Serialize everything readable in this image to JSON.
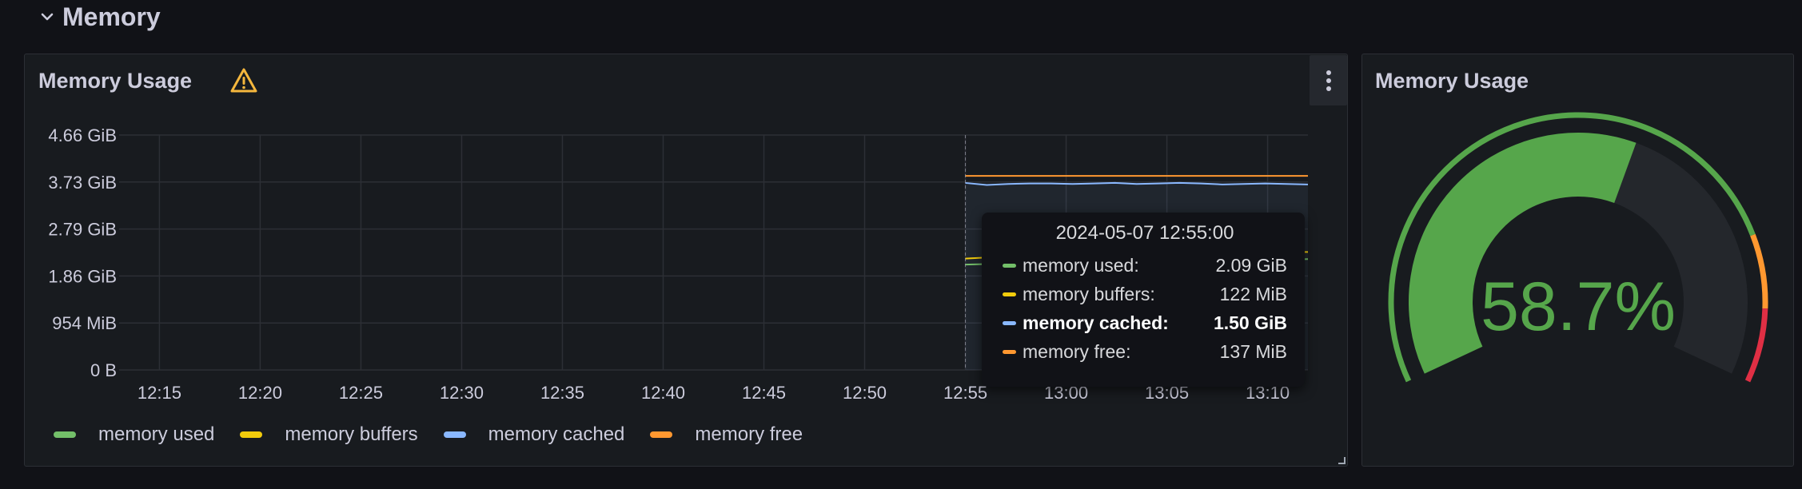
{
  "row": {
    "title": "Memory"
  },
  "graph_panel": {
    "title": "Memory Usage",
    "tooltip": {
      "time": "2024-05-07 12:55:00",
      "rows": [
        {
          "name": "memory used:",
          "value": "2.09 GiB",
          "color": "#73bf69"
        },
        {
          "name": "memory buffers:",
          "value": "122 MiB",
          "color": "#f2cc0c"
        },
        {
          "name": "memory cached:",
          "value": "1.50 GiB",
          "color": "#8ab8ff"
        },
        {
          "name": "memory free:",
          "value": "137 MiB",
          "color": "#ff9830"
        }
      ]
    },
    "legend": [
      {
        "label": "memory used",
        "color": "#73bf69"
      },
      {
        "label": "memory buffers",
        "color": "#f2cc0c"
      },
      {
        "label": "memory cached",
        "color": "#8ab8ff"
      },
      {
        "label": "memory free",
        "color": "#ff9830"
      }
    ]
  },
  "gauge_panel": {
    "title": "Memory Usage",
    "value_text": "58.7%",
    "value": 58.7,
    "min": 0,
    "max": 100,
    "value_color": "#56a64b",
    "threshold_colors": [
      "#56a64b",
      "#ff9830",
      "#e02f44"
    ]
  },
  "chart_data": {
    "type": "line",
    "y_ticks": [
      "0 B",
      "954 MiB",
      "1.86 GiB",
      "2.79 GiB",
      "3.73 GiB",
      "4.66 GiB"
    ],
    "x_ticks": [
      "12:15",
      "12:20",
      "12:25",
      "12:30",
      "12:35",
      "12:40",
      "12:45",
      "12:50",
      "12:55",
      "13:00",
      "13:05",
      "13:10"
    ],
    "x_start_minute": "12:13",
    "x_end_minute": "13:12",
    "ylim_gib": [
      0,
      4.66
    ],
    "data_start": "12:55",
    "series": [
      {
        "name": "memory used",
        "color": "#73bf69",
        "values_gib": [
          2.09,
          2.1,
          2.12,
          2.11,
          2.13,
          2.12,
          2.14,
          2.15,
          2.13,
          2.14,
          2.16,
          2.15,
          2.17,
          2.18,
          2.17,
          2.19,
          2.2
        ]
      },
      {
        "name": "memory buffers",
        "color": "#f2cc0c",
        "values_gib": [
          2.21,
          2.23,
          2.24,
          2.25,
          2.26,
          2.27,
          2.27,
          2.28,
          2.29,
          2.3,
          2.3,
          2.31,
          2.32,
          2.32,
          2.33,
          2.34,
          2.34
        ]
      },
      {
        "name": "memory cached",
        "color": "#8ab8ff",
        "values_gib": [
          3.71,
          3.67,
          3.69,
          3.7,
          3.7,
          3.69,
          3.7,
          3.71,
          3.69,
          3.7,
          3.71,
          3.7,
          3.68,
          3.69,
          3.7,
          3.69,
          3.68
        ]
      },
      {
        "name": "memory free",
        "color": "#ff9830",
        "values_gib": [
          3.85,
          3.85,
          3.85,
          3.85,
          3.85,
          3.85,
          3.85,
          3.85,
          3.85,
          3.85,
          3.85,
          3.85,
          3.85,
          3.85,
          3.85,
          3.85,
          3.85
        ]
      }
    ]
  }
}
